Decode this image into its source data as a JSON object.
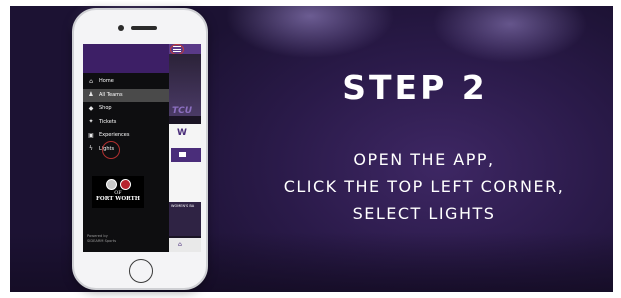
{
  "slide": {
    "headline": "STEP 2",
    "instructions": [
      "OPEN THE APP,",
      "CLICK THE TOP LEFT CORNER,",
      "SELECT LIGHTS"
    ]
  },
  "app": {
    "menu": [
      {
        "icon": "home-icon",
        "label": "Home"
      },
      {
        "icon": "teams-icon",
        "label": "All Teams"
      },
      {
        "icon": "shop-tag-icon",
        "label": "Shop"
      },
      {
        "icon": "ticket-icon",
        "label": "Tickets"
      },
      {
        "icon": "gift-icon",
        "label": "Experiences"
      },
      {
        "icon": "lightning-icon",
        "label": "Lights"
      }
    ],
    "badge": {
      "of": "OF",
      "city": "FORT WORTH"
    },
    "powered": [
      "Powered by",
      "SIDEARM Sports"
    ],
    "hero_text": "TCU",
    "promo_text": "WOMEN'S BA"
  },
  "colors": {
    "brand_purple": "#4a2d7a",
    "background_purple": "#2a1a49",
    "highlight_circle": "#c23a3a"
  }
}
